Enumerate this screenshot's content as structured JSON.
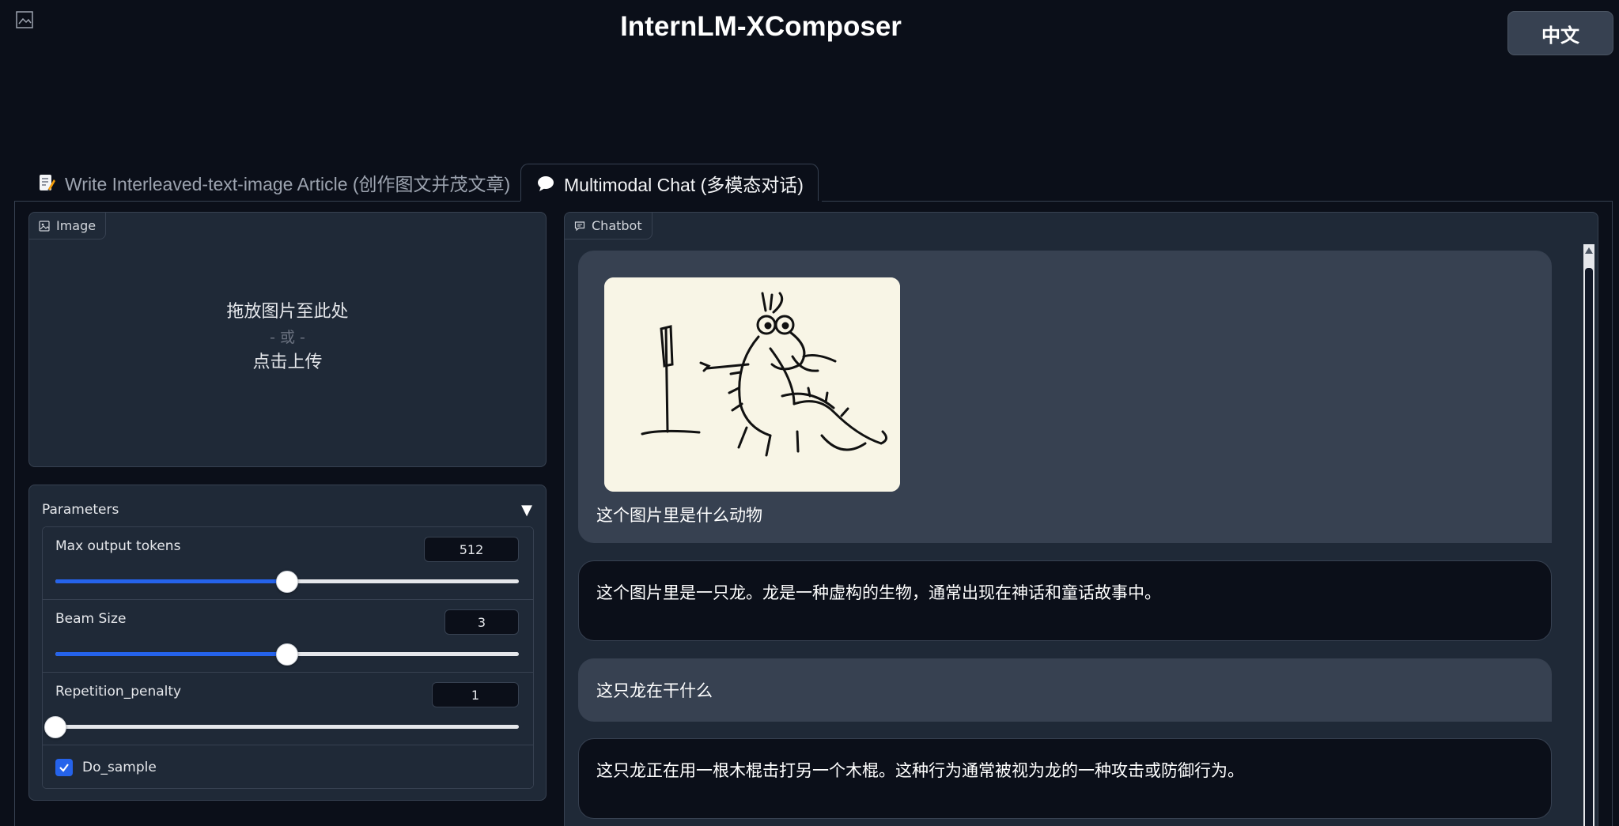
{
  "header": {
    "app_title": "InternLM-XComposer",
    "language_button": "中文"
  },
  "tabs": [
    {
      "label": "Write Interleaved-text-image Article (创作图文并茂文章)",
      "icon": "memo-icon",
      "active": false
    },
    {
      "label": "Multimodal Chat (多模态对话)",
      "icon": "speech-bubble-icon",
      "active": true
    }
  ],
  "image_upload": {
    "label": "Image",
    "drop_text": "拖放图片至此处",
    "or_text": "- 或 -",
    "click_text": "点击上传"
  },
  "parameters": {
    "title": "Parameters",
    "sliders": [
      {
        "label": "Max output tokens",
        "value": "512",
        "fraction": 0.5
      },
      {
        "label": "Beam Size",
        "value": "3",
        "fraction": 0.5
      },
      {
        "label": "Repetition_penalty",
        "value": "1",
        "fraction": 0.0
      }
    ],
    "do_sample": {
      "label": "Do_sample",
      "checked": true
    }
  },
  "chatbot": {
    "label": "Chatbot",
    "messages": [
      {
        "role": "user",
        "has_image": true,
        "text": "这个图片里是什么动物"
      },
      {
        "role": "bot",
        "text": "这个图片里是一只龙。龙是一种虚构的生物，通常出现在神话和童话故事中。"
      },
      {
        "role": "user",
        "text": "这只龙在干什么"
      },
      {
        "role": "bot",
        "text": "这只龙正在用一根木棍击打另一个木棍。这种行为通常被视为龙的一种攻击或防御行为。"
      }
    ]
  },
  "colors": {
    "background": "#0b0f19",
    "panel": "#1f2937",
    "border": "#374151",
    "accent": "#2563eb"
  }
}
